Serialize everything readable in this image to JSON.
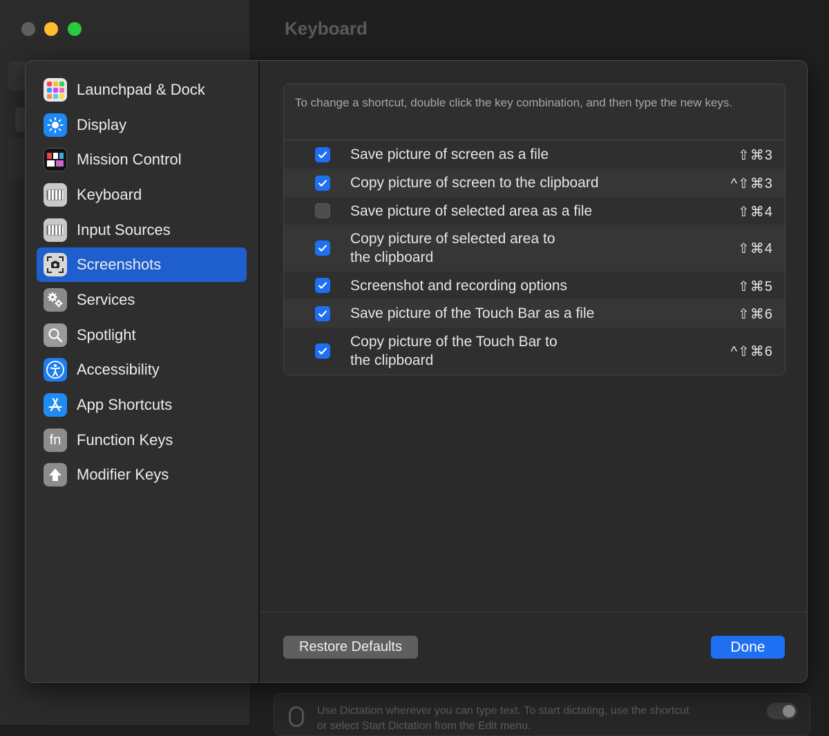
{
  "window": {
    "title": "Keyboard",
    "background_footer_line1": "Use Dictation wherever you can type text. To start dictating, use the shortcut",
    "background_footer_line2": "or select Start Dictation from the Edit menu."
  },
  "sidebar": {
    "items": [
      {
        "label": "Launchpad & Dock",
        "icon": "launchpad-icon",
        "selected": false
      },
      {
        "label": "Display",
        "icon": "sun-icon",
        "selected": false
      },
      {
        "label": "Mission Control",
        "icon": "mission-control-icon",
        "selected": false
      },
      {
        "label": "Keyboard",
        "icon": "keyboard-icon",
        "selected": false
      },
      {
        "label": "Input Sources",
        "icon": "keyboard-icon",
        "selected": false
      },
      {
        "label": "Screenshots",
        "icon": "camera-icon",
        "selected": true
      },
      {
        "label": "Services",
        "icon": "gears-icon",
        "selected": false
      },
      {
        "label": "Spotlight",
        "icon": "magnifier-icon",
        "selected": false
      },
      {
        "label": "Accessibility",
        "icon": "accessibility-icon",
        "selected": false
      },
      {
        "label": "App Shortcuts",
        "icon": "app-store-icon",
        "selected": false
      },
      {
        "label": "Function Keys",
        "icon": "fn-icon",
        "fn_text": "fn",
        "selected": false
      },
      {
        "label": "Modifier Keys",
        "icon": "up-arrow-icon",
        "selected": false
      }
    ]
  },
  "panel": {
    "help_text": "To change a shortcut, double click the key combination, and then type the new keys.",
    "shortcuts": [
      {
        "line1": "Save picture of screen as a file",
        "line2": "",
        "keys": "⇧⌘3",
        "enabled": true
      },
      {
        "line1": "Copy picture of screen to the clipboard",
        "line2": "",
        "keys": "^⇧⌘3",
        "enabled": true
      },
      {
        "line1": "Save picture of selected area as a file",
        "line2": "",
        "keys": "⇧⌘4",
        "enabled": false
      },
      {
        "line1": "Copy picture of selected area to",
        "line2": "the clipboard",
        "keys": "⇧⌘4",
        "enabled": true
      },
      {
        "line1": "Screenshot and recording options",
        "line2": "",
        "keys": "⇧⌘5",
        "enabled": true
      },
      {
        "line1": "Save picture of the Touch Bar as a file",
        "line2": "",
        "keys": "⇧⌘6",
        "enabled": true
      },
      {
        "line1": "Copy picture of the Touch Bar to",
        "line2": "the clipboard",
        "keys": "^⇧⌘6",
        "enabled": true
      }
    ]
  },
  "buttons": {
    "restore_label": "Restore Defaults",
    "done_label": "Done"
  },
  "colors": {
    "accent": "#1e6ff2",
    "selected_sidebar": "#1f5fcd"
  }
}
